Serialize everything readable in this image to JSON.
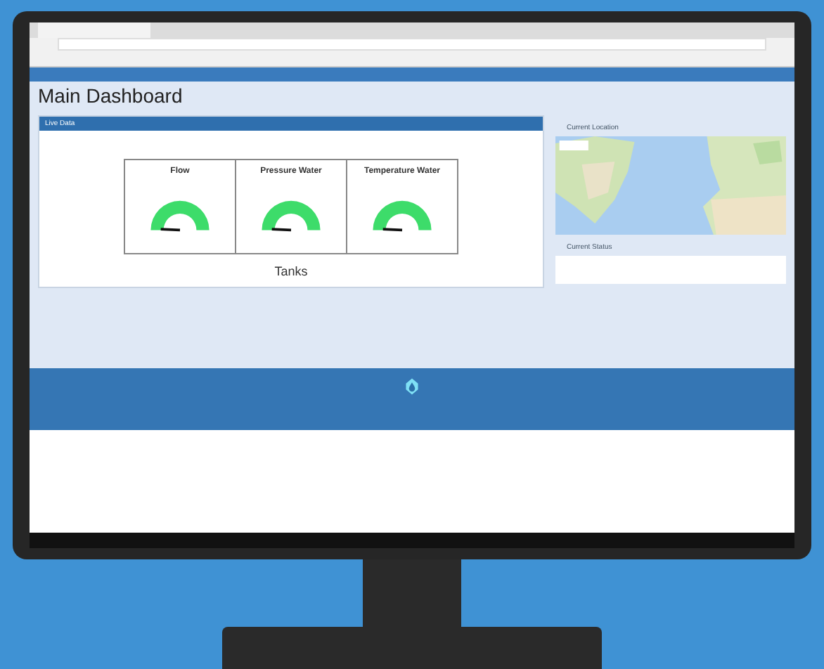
{
  "page": {
    "title": "Main Dashboard"
  },
  "live_data": {
    "title": "Live Data",
    "gauges": [
      {
        "title": "Flow"
      },
      {
        "title": "Pressure Water"
      },
      {
        "title": "Temperature Water"
      }
    ],
    "tanks_label": "Tanks"
  },
  "location": {
    "title": "Current Location"
  },
  "status": {
    "title": "Current Status"
  }
}
